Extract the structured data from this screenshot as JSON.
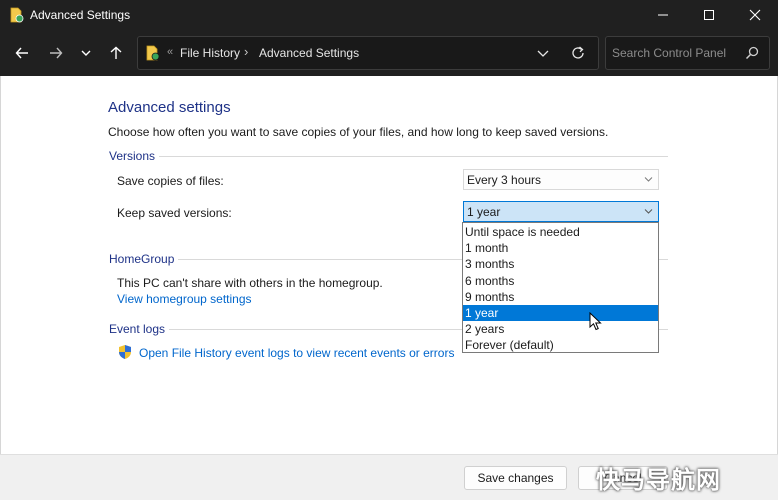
{
  "window": {
    "title": "Advanced Settings"
  },
  "address": {
    "crumb_sep": "«",
    "crumbs": [
      "File History",
      "Advanced Settings"
    ],
    "separator": "›"
  },
  "search": {
    "placeholder": "Search Control Panel"
  },
  "page": {
    "heading": "Advanced settings",
    "description": "Choose how often you want to save copies of your files, and how long to keep saved versions."
  },
  "versions": {
    "group_label": "Versions",
    "save_copies_label": "Save copies of files:",
    "save_copies_value": "Every 3 hours",
    "keep_versions_label": "Keep saved versions:",
    "keep_versions_value": "1 year",
    "options": [
      "Until space is needed",
      "1 month",
      "3 months",
      "6 months",
      "9 months",
      "1 year",
      "2 years",
      "Forever (default)"
    ],
    "selected_option": "1 year"
  },
  "homegroup": {
    "group_label": "HomeGroup",
    "status": "This PC can't share with others in the homegroup.",
    "link": "View homegroup settings"
  },
  "event_logs": {
    "group_label": "Event logs",
    "link": "Open File History event logs to view recent events or errors"
  },
  "footer": {
    "save_label": "Save changes",
    "cancel_label": "Cancel"
  },
  "watermark": "快马导航网",
  "colors": {
    "accent": "#0078d7",
    "heading": "#1e3287",
    "link": "#0066cc",
    "titlebar": "#202020"
  }
}
